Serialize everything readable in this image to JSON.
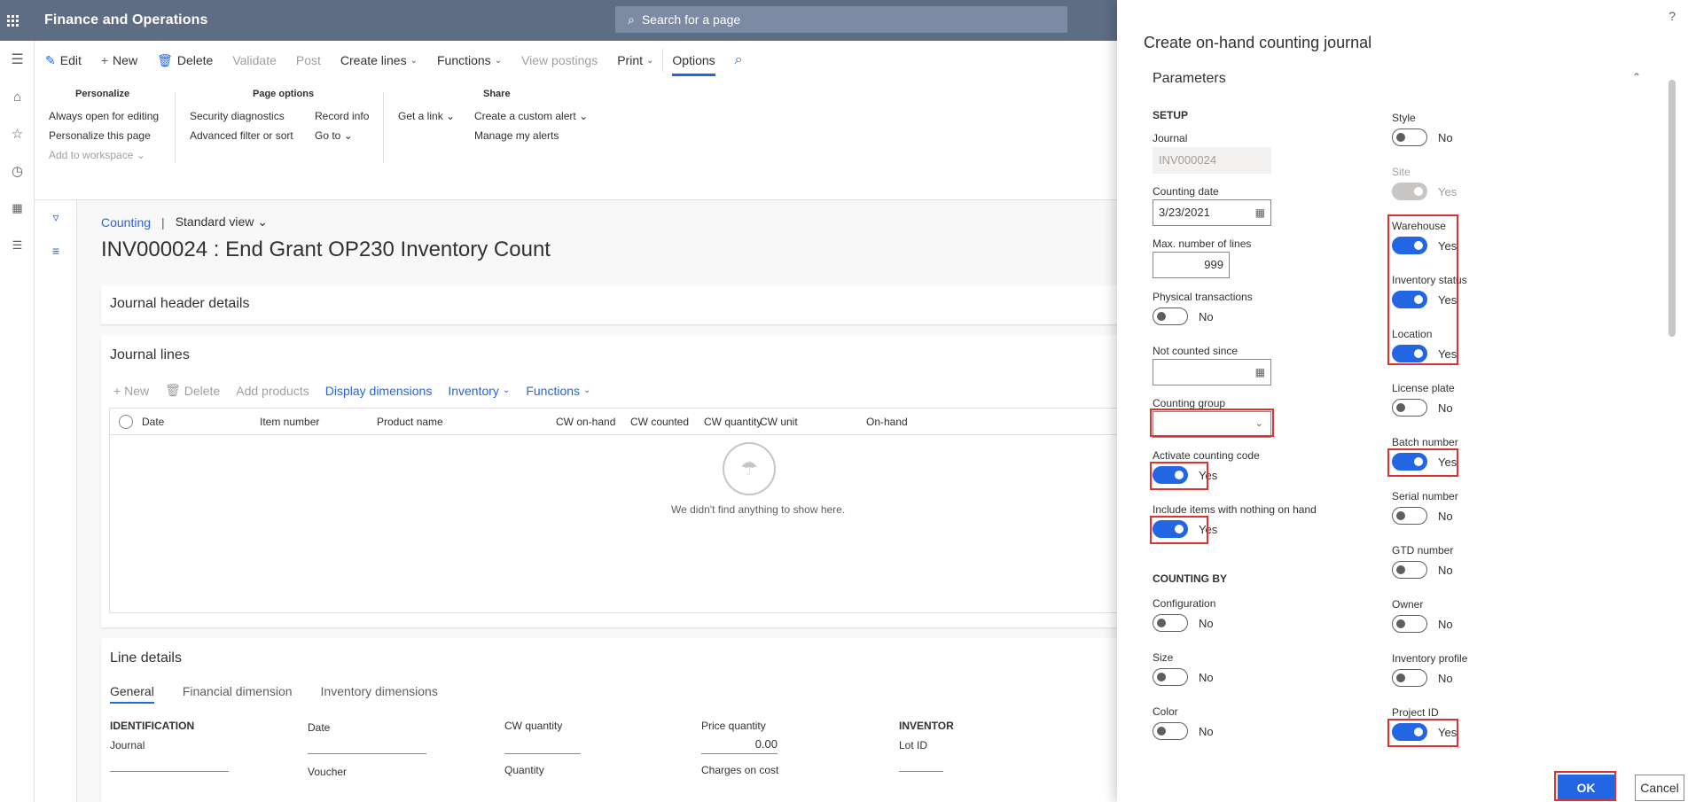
{
  "topbar": {
    "app_title": "Finance and Operations",
    "search_placeholder": "Search for a page"
  },
  "actionpane": {
    "edit": "Edit",
    "new": "New",
    "delete": "Delete",
    "validate": "Validate",
    "post": "Post",
    "create_lines": "Create lines",
    "functions": "Functions",
    "view_postings": "View postings",
    "print": "Print",
    "options": "Options"
  },
  "ribbon": {
    "personalize": {
      "title": "Personalize",
      "items": [
        "Always open for editing",
        "Personalize this page",
        "Add to workspace"
      ]
    },
    "page_options": {
      "title": "Page options",
      "items": [
        "Security diagnostics",
        "Advanced filter or sort",
        "Record info",
        "Go to"
      ]
    },
    "share": {
      "title": "Share",
      "items": [
        "Get a link",
        "Create a custom alert",
        "Manage my alerts"
      ]
    }
  },
  "main": {
    "breadcrumb_link": "Counting",
    "breadcrumb_sep": "|",
    "view": "Standard view",
    "page_title": "INV000024 : End Grant OP230 Inventory Count",
    "journal_header": "Journal header details",
    "journal_lines": "Journal lines",
    "grid_toolbar": {
      "new": "New",
      "delete": "Delete",
      "add_products": "Add products",
      "display_dimensions": "Display dimensions",
      "inventory": "Inventory",
      "functions": "Functions"
    },
    "grid_columns": [
      "Date",
      "Item number",
      "Product name",
      "CW on-hand",
      "CW counted",
      "CW quantity",
      "CW unit",
      "On-hand"
    ],
    "empty_text": "We didn't find anything to show here.",
    "line_details": "Line details",
    "tabs": [
      "General",
      "Financial dimension",
      "Inventory dimensions"
    ],
    "fields": {
      "identification": "IDENTIFICATION",
      "journal": "Journal",
      "voucher": "Voucher",
      "date": "Date",
      "cw_quantity": "CW quantity",
      "quantity": "Quantity",
      "price_quantity": "Price quantity",
      "price_quantity_value": "0.00",
      "charges_on_cost": "Charges on cost",
      "inventory": "INVENTOR",
      "lot_id": "Lot ID"
    }
  },
  "dialog": {
    "title": "Create on-hand counting journal",
    "help": "?",
    "parameters": "Parameters",
    "setup": "SETUP",
    "journal_label": "Journal",
    "journal_value": "INV000024",
    "counting_date_label": "Counting date",
    "counting_date_value": "3/23/2021",
    "max_lines_label": "Max. number of lines",
    "max_lines_value": "999",
    "physical_label": "Physical transactions",
    "physical_value": "No",
    "not_counted_label": "Not counted since",
    "counting_group_label": "Counting group",
    "activate_code_label": "Activate counting code",
    "activate_code_value": "Yes",
    "include_items_label": "Include items with nothing on hand",
    "include_items_value": "Yes",
    "counting_by": "COUNTING BY",
    "configuration_label": "Configuration",
    "configuration_value": "No",
    "size_label": "Size",
    "size_value": "No",
    "color_label": "Color",
    "color_value": "No",
    "style_label": "Style",
    "style_value": "No",
    "site_label": "Site",
    "site_value": "Yes",
    "warehouse_label": "Warehouse",
    "warehouse_value": "Yes",
    "inv_status_label": "Inventory status",
    "inv_status_value": "Yes",
    "location_label": "Location",
    "location_value": "Yes",
    "license_label": "License plate",
    "license_value": "No",
    "batch_label": "Batch number",
    "batch_value": "Yes",
    "serial_label": "Serial number",
    "serial_value": "No",
    "gtd_label": "GTD number",
    "gtd_value": "No",
    "owner_label": "Owner",
    "owner_value": "No",
    "inv_profile_label": "Inventory profile",
    "inv_profile_value": "No",
    "project_label": "Project ID",
    "project_value": "Yes",
    "ok": "OK",
    "cancel": "Cancel"
  },
  "colors": {
    "accent": "#2266e3",
    "topbar": "#5e6c84",
    "highlight": "#e0312f"
  }
}
